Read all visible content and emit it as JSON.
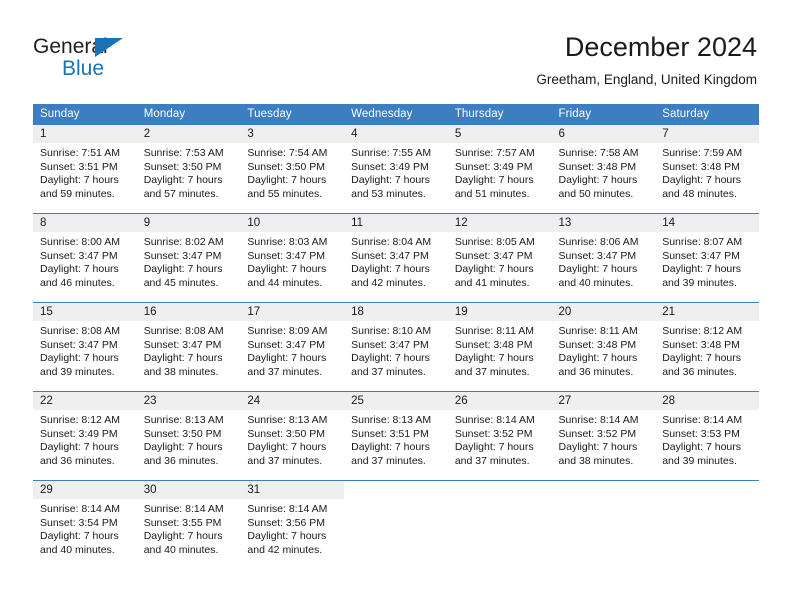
{
  "brand": {
    "name_part1": "General",
    "name_part2": "Blue"
  },
  "header": {
    "title": "December 2024",
    "location": "Greetham, England, United Kingdom"
  },
  "colors": {
    "header_blue": "#3c7ebf",
    "brand_blue": "#1a72b8",
    "daynum_band": "#efefef",
    "text": "#1a1a1a"
  },
  "weekday_headers": [
    "Sunday",
    "Monday",
    "Tuesday",
    "Wednesday",
    "Thursday",
    "Friday",
    "Saturday"
  ],
  "weeks": [
    [
      {
        "day": "1",
        "sunrise": "Sunrise: 7:51 AM",
        "sunset": "Sunset: 3:51 PM",
        "daylight1": "Daylight: 7 hours",
        "daylight2": "and 59 minutes."
      },
      {
        "day": "2",
        "sunrise": "Sunrise: 7:53 AM",
        "sunset": "Sunset: 3:50 PM",
        "daylight1": "Daylight: 7 hours",
        "daylight2": "and 57 minutes."
      },
      {
        "day": "3",
        "sunrise": "Sunrise: 7:54 AM",
        "sunset": "Sunset: 3:50 PM",
        "daylight1": "Daylight: 7 hours",
        "daylight2": "and 55 minutes."
      },
      {
        "day": "4",
        "sunrise": "Sunrise: 7:55 AM",
        "sunset": "Sunset: 3:49 PM",
        "daylight1": "Daylight: 7 hours",
        "daylight2": "and 53 minutes."
      },
      {
        "day": "5",
        "sunrise": "Sunrise: 7:57 AM",
        "sunset": "Sunset: 3:49 PM",
        "daylight1": "Daylight: 7 hours",
        "daylight2": "and 51 minutes."
      },
      {
        "day": "6",
        "sunrise": "Sunrise: 7:58 AM",
        "sunset": "Sunset: 3:48 PM",
        "daylight1": "Daylight: 7 hours",
        "daylight2": "and 50 minutes."
      },
      {
        "day": "7",
        "sunrise": "Sunrise: 7:59 AM",
        "sunset": "Sunset: 3:48 PM",
        "daylight1": "Daylight: 7 hours",
        "daylight2": "and 48 minutes."
      }
    ],
    [
      {
        "day": "8",
        "sunrise": "Sunrise: 8:00 AM",
        "sunset": "Sunset: 3:47 PM",
        "daylight1": "Daylight: 7 hours",
        "daylight2": "and 46 minutes."
      },
      {
        "day": "9",
        "sunrise": "Sunrise: 8:02 AM",
        "sunset": "Sunset: 3:47 PM",
        "daylight1": "Daylight: 7 hours",
        "daylight2": "and 45 minutes."
      },
      {
        "day": "10",
        "sunrise": "Sunrise: 8:03 AM",
        "sunset": "Sunset: 3:47 PM",
        "daylight1": "Daylight: 7 hours",
        "daylight2": "and 44 minutes."
      },
      {
        "day": "11",
        "sunrise": "Sunrise: 8:04 AM",
        "sunset": "Sunset: 3:47 PM",
        "daylight1": "Daylight: 7 hours",
        "daylight2": "and 42 minutes."
      },
      {
        "day": "12",
        "sunrise": "Sunrise: 8:05 AM",
        "sunset": "Sunset: 3:47 PM",
        "daylight1": "Daylight: 7 hours",
        "daylight2": "and 41 minutes."
      },
      {
        "day": "13",
        "sunrise": "Sunrise: 8:06 AM",
        "sunset": "Sunset: 3:47 PM",
        "daylight1": "Daylight: 7 hours",
        "daylight2": "and 40 minutes."
      },
      {
        "day": "14",
        "sunrise": "Sunrise: 8:07 AM",
        "sunset": "Sunset: 3:47 PM",
        "daylight1": "Daylight: 7 hours",
        "daylight2": "and 39 minutes."
      }
    ],
    [
      {
        "day": "15",
        "sunrise": "Sunrise: 8:08 AM",
        "sunset": "Sunset: 3:47 PM",
        "daylight1": "Daylight: 7 hours",
        "daylight2": "and 39 minutes."
      },
      {
        "day": "16",
        "sunrise": "Sunrise: 8:08 AM",
        "sunset": "Sunset: 3:47 PM",
        "daylight1": "Daylight: 7 hours",
        "daylight2": "and 38 minutes."
      },
      {
        "day": "17",
        "sunrise": "Sunrise: 8:09 AM",
        "sunset": "Sunset: 3:47 PM",
        "daylight1": "Daylight: 7 hours",
        "daylight2": "and 37 minutes."
      },
      {
        "day": "18",
        "sunrise": "Sunrise: 8:10 AM",
        "sunset": "Sunset: 3:47 PM",
        "daylight1": "Daylight: 7 hours",
        "daylight2": "and 37 minutes."
      },
      {
        "day": "19",
        "sunrise": "Sunrise: 8:11 AM",
        "sunset": "Sunset: 3:48 PM",
        "daylight1": "Daylight: 7 hours",
        "daylight2": "and 37 minutes."
      },
      {
        "day": "20",
        "sunrise": "Sunrise: 8:11 AM",
        "sunset": "Sunset: 3:48 PM",
        "daylight1": "Daylight: 7 hours",
        "daylight2": "and 36 minutes."
      },
      {
        "day": "21",
        "sunrise": "Sunrise: 8:12 AM",
        "sunset": "Sunset: 3:48 PM",
        "daylight1": "Daylight: 7 hours",
        "daylight2": "and 36 minutes."
      }
    ],
    [
      {
        "day": "22",
        "sunrise": "Sunrise: 8:12 AM",
        "sunset": "Sunset: 3:49 PM",
        "daylight1": "Daylight: 7 hours",
        "daylight2": "and 36 minutes."
      },
      {
        "day": "23",
        "sunrise": "Sunrise: 8:13 AM",
        "sunset": "Sunset: 3:50 PM",
        "daylight1": "Daylight: 7 hours",
        "daylight2": "and 36 minutes."
      },
      {
        "day": "24",
        "sunrise": "Sunrise: 8:13 AM",
        "sunset": "Sunset: 3:50 PM",
        "daylight1": "Daylight: 7 hours",
        "daylight2": "and 37 minutes."
      },
      {
        "day": "25",
        "sunrise": "Sunrise: 8:13 AM",
        "sunset": "Sunset: 3:51 PM",
        "daylight1": "Daylight: 7 hours",
        "daylight2": "and 37 minutes."
      },
      {
        "day": "26",
        "sunrise": "Sunrise: 8:14 AM",
        "sunset": "Sunset: 3:52 PM",
        "daylight1": "Daylight: 7 hours",
        "daylight2": "and 37 minutes."
      },
      {
        "day": "27",
        "sunrise": "Sunrise: 8:14 AM",
        "sunset": "Sunset: 3:52 PM",
        "daylight1": "Daylight: 7 hours",
        "daylight2": "and 38 minutes."
      },
      {
        "day": "28",
        "sunrise": "Sunrise: 8:14 AM",
        "sunset": "Sunset: 3:53 PM",
        "daylight1": "Daylight: 7 hours",
        "daylight2": "and 39 minutes."
      }
    ],
    [
      {
        "day": "29",
        "sunrise": "Sunrise: 8:14 AM",
        "sunset": "Sunset: 3:54 PM",
        "daylight1": "Daylight: 7 hours",
        "daylight2": "and 40 minutes."
      },
      {
        "day": "30",
        "sunrise": "Sunrise: 8:14 AM",
        "sunset": "Sunset: 3:55 PM",
        "daylight1": "Daylight: 7 hours",
        "daylight2": "and 40 minutes."
      },
      {
        "day": "31",
        "sunrise": "Sunrise: 8:14 AM",
        "sunset": "Sunset: 3:56 PM",
        "daylight1": "Daylight: 7 hours",
        "daylight2": "and 42 minutes."
      },
      {
        "day": "",
        "sunrise": "",
        "sunset": "",
        "daylight1": "",
        "daylight2": ""
      },
      {
        "day": "",
        "sunrise": "",
        "sunset": "",
        "daylight1": "",
        "daylight2": ""
      },
      {
        "day": "",
        "sunrise": "",
        "sunset": "",
        "daylight1": "",
        "daylight2": ""
      },
      {
        "day": "",
        "sunrise": "",
        "sunset": "",
        "daylight1": "",
        "daylight2": ""
      }
    ]
  ]
}
